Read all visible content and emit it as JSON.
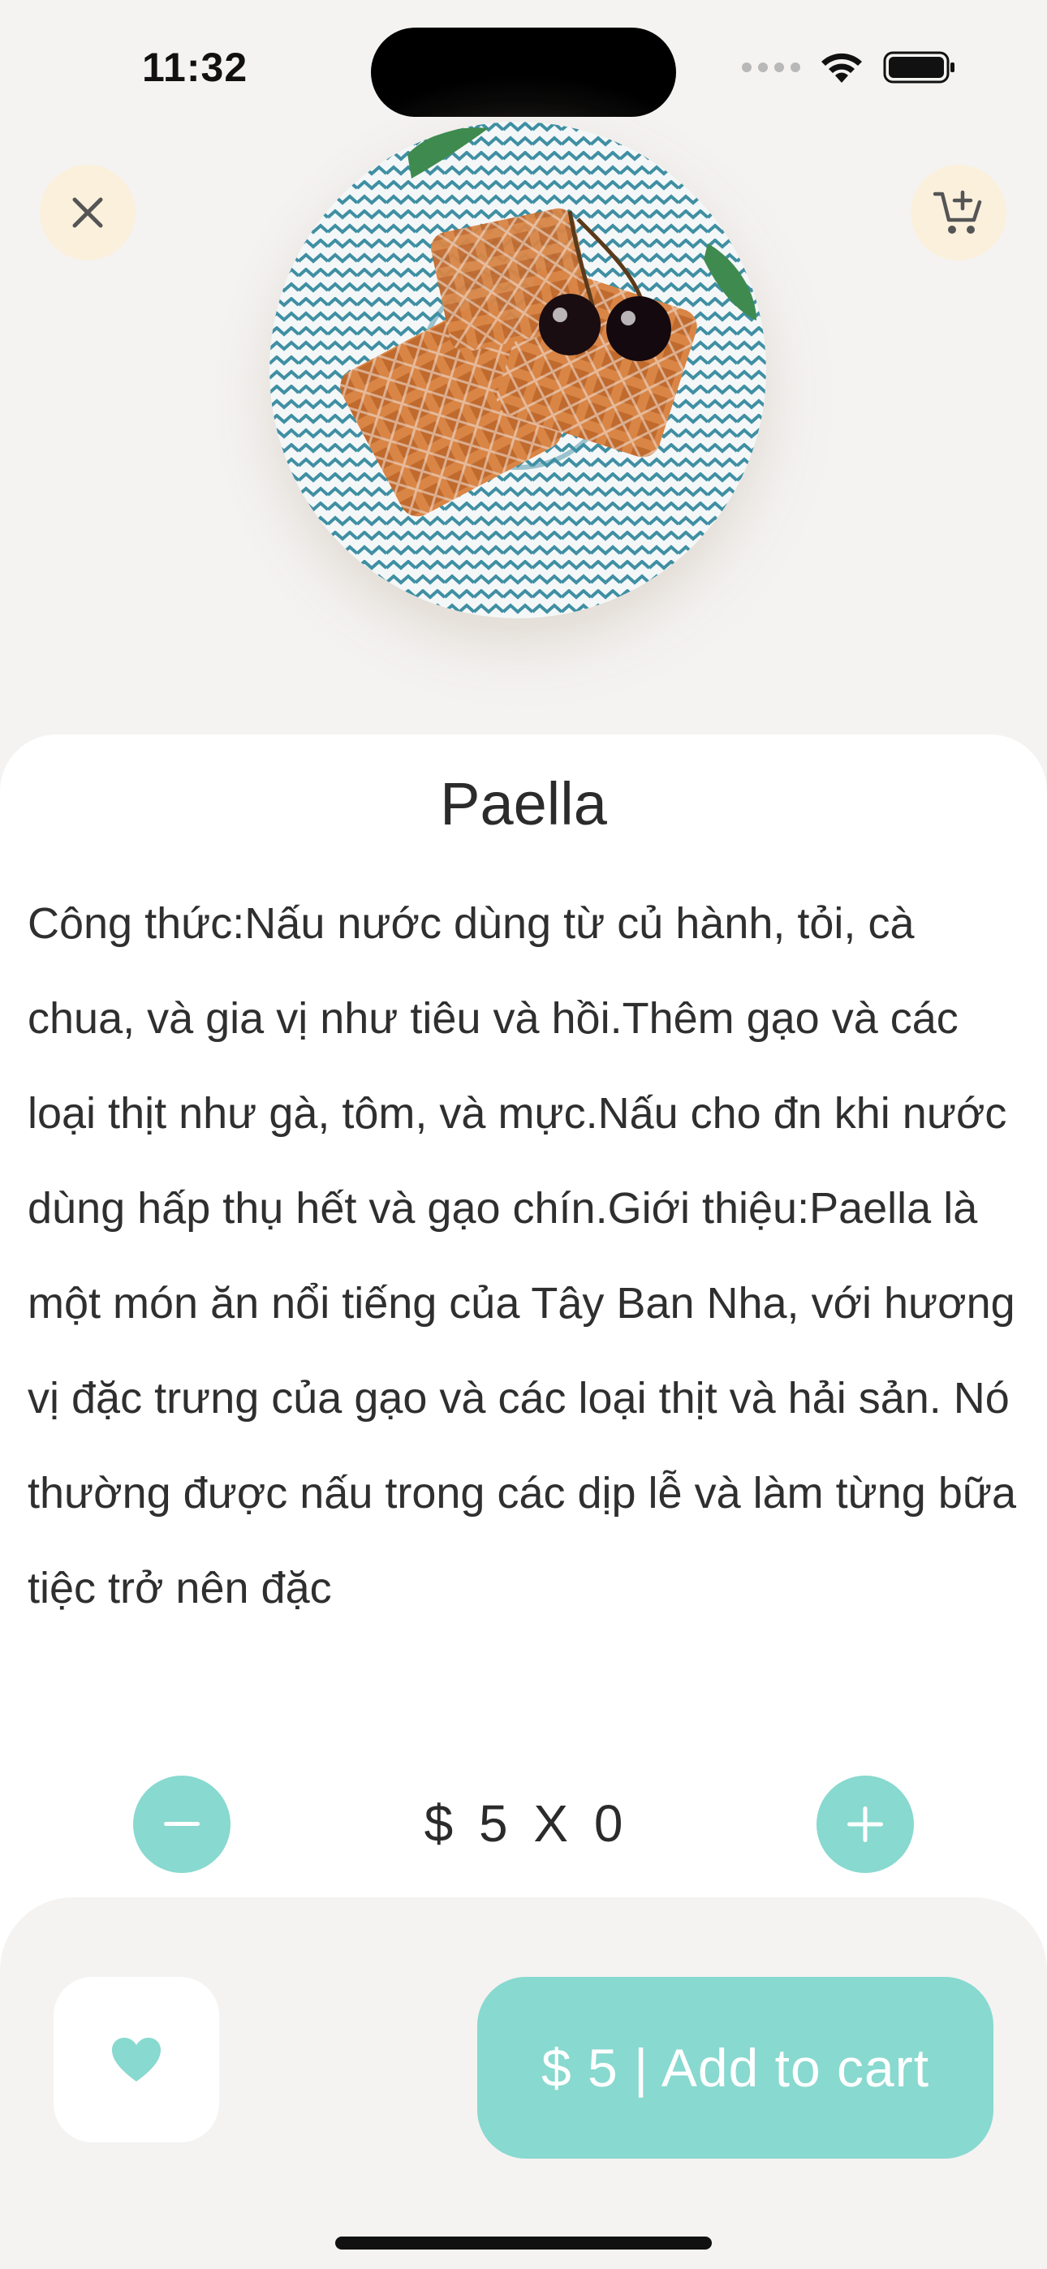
{
  "status_bar": {
    "time": "11:32",
    "icons": [
      "signal-icon",
      "wifi-icon",
      "battery-icon"
    ]
  },
  "header": {
    "close_icon": "close-icon",
    "cart_icon": "add-to-cart-icon"
  },
  "product": {
    "image_alt": "waffles-with-cherries-plate",
    "title": "Paella",
    "description": "Công thức:Nấu nước dùng từ củ hành, tỏi, cà chua, và gia vị như tiêu và hồi.Thêm gạo và các loại thịt như gà, tôm, và mực.Nấu cho đn khi nước dùng hấp thụ hết và gạo chín.Giới thiệu:Paella là một món ăn nổi tiếng của Tây Ban Nha, với hương vị đặc trưng của gạo và các loại thịt và hải sản. Nó thường được nấu trong các dịp lễ và làm từng bữa tiệc trở nên đặc"
  },
  "quantity": {
    "minus_icon": "minus-icon",
    "plus_icon": "plus-icon",
    "price_text": "$ 5 X  0"
  },
  "actions": {
    "favorite_icon": "heart-icon",
    "add_to_cart_label": "$ 5 | Add to cart"
  },
  "colors": {
    "accent": "#88d9cf",
    "icon_button_bg": "#fbf0dc",
    "background": "#f4f3f2",
    "text": "#2b2b2b"
  }
}
